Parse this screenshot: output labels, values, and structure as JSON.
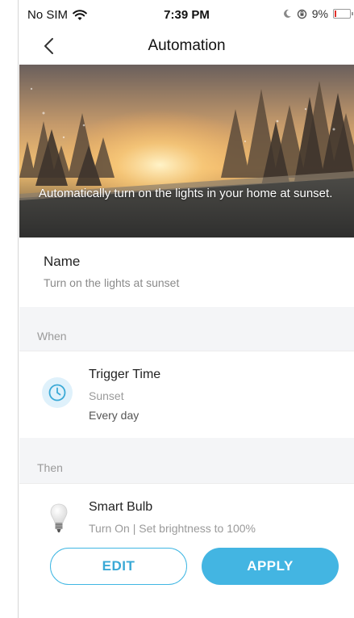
{
  "status_bar": {
    "carrier": "No SIM",
    "time": "7:39 PM",
    "battery_text": "9%",
    "battery_level": 0.09,
    "icons": [
      "wifi-icon",
      "moon-icon",
      "orientation-lock-icon",
      "battery-icon"
    ]
  },
  "nav": {
    "title": "Automation",
    "back_icon": "chevron-left-icon"
  },
  "hero": {
    "caption": "Automatically turn on the lights in your home at sunset."
  },
  "name_section": {
    "label": "Name",
    "value": "Turn on the lights at sunset"
  },
  "when_section": {
    "header": "When",
    "trigger": {
      "icon": "clock-icon",
      "title": "Trigger Time",
      "subtitle": "Sunset",
      "repeat": "Every day"
    }
  },
  "then_section": {
    "header": "Then",
    "action": {
      "icon": "light-bulb-icon",
      "title": "Smart Bulb",
      "description": "Turn On | Set brightness to 100%"
    }
  },
  "actions": {
    "edit_label": "EDIT",
    "apply_label": "APPLY"
  },
  "colors": {
    "accent": "#43b5e2",
    "section_background": "#f4f5f7",
    "secondary_text": "#9a9a9a"
  }
}
